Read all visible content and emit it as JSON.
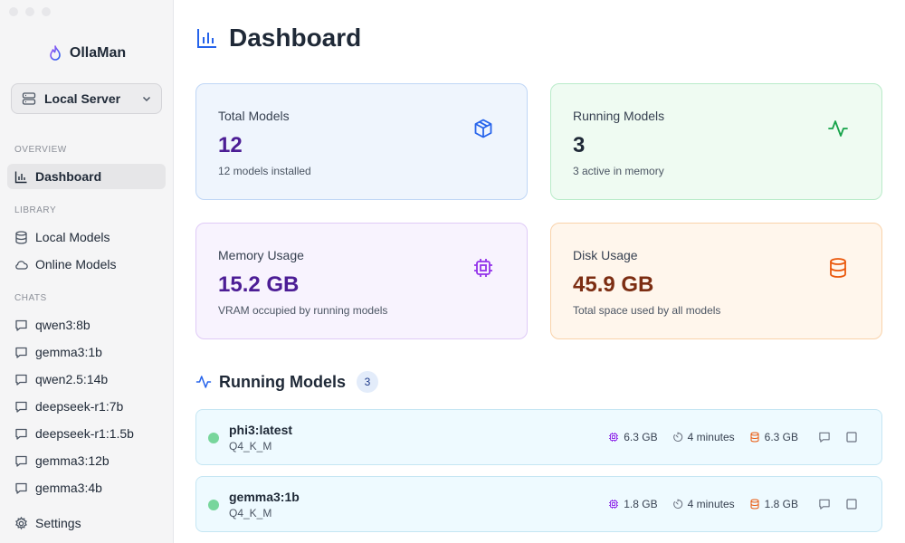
{
  "app": {
    "name": "OllaMan"
  },
  "server": {
    "label": "Local Server"
  },
  "sidebar": {
    "sections": {
      "overview": "OVERVIEW",
      "library": "LIBRARY",
      "chats": "CHATS"
    },
    "overview_items": [
      {
        "label": "Dashboard",
        "icon": "bar-chart-icon",
        "active": true
      }
    ],
    "library_items": [
      {
        "label": "Local Models",
        "icon": "database-icon"
      },
      {
        "label": "Online Models",
        "icon": "cloud-icon"
      }
    ],
    "chats": [
      {
        "label": "qwen3:8b"
      },
      {
        "label": "gemma3:1b"
      },
      {
        "label": "qwen2.5:14b"
      },
      {
        "label": "deepseek-r1:7b"
      },
      {
        "label": "deepseek-r1:1.5b"
      },
      {
        "label": "gemma3:12b"
      },
      {
        "label": "gemma3:4b"
      }
    ],
    "settings_label": "Settings"
  },
  "page": {
    "title": "Dashboard"
  },
  "cards": [
    {
      "label": "Total Models",
      "value": "12",
      "sub": "12 models installed",
      "icon": "box-icon",
      "color": "#4c1d95"
    },
    {
      "label": "Running Models",
      "value": "3",
      "sub": "3 active in memory",
      "icon": "activity-icon",
      "color": "#1f2937"
    },
    {
      "label": "Memory Usage",
      "value": "15.2 GB",
      "sub": "VRAM occupied by running models",
      "icon": "cpu-icon",
      "color": "#4c1d95"
    },
    {
      "label": "Disk Usage",
      "value": "45.9 GB",
      "sub": "Total space used by all models",
      "icon": "storage-icon",
      "color": "#7c2d12"
    }
  ],
  "running": {
    "title": "Running Models",
    "count": "3",
    "models": [
      {
        "name": "phi3:latest",
        "quant": "Q4_K_M",
        "vram": "6.3 GB",
        "expires": "4 minutes",
        "size": "6.3 GB"
      },
      {
        "name": "gemma3:1b",
        "quant": "Q4_K_M",
        "vram": "1.8 GB",
        "expires": "4 minutes",
        "size": "1.8 GB"
      }
    ]
  },
  "colors": {
    "accent": "#2563eb",
    "green": "#16a34a",
    "purple": "#9333ea",
    "orange": "#ea580c",
    "running_dot": "#78d69c"
  }
}
